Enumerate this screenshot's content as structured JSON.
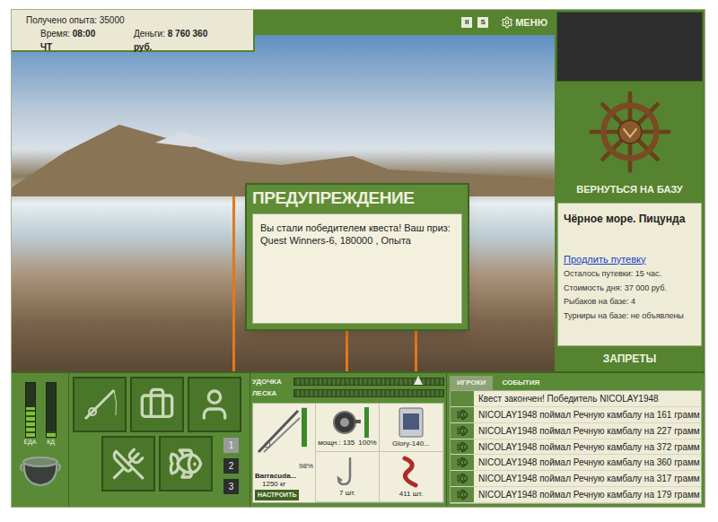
{
  "top_info": {
    "experience": "Получено опыта: 35000",
    "time_label": "Время:",
    "time": "08:00 ЧТ",
    "money_label": "Деньги:",
    "money": "8 760 360 руб."
  },
  "top_bar": {
    "buttons": [
      "II",
      "S"
    ],
    "menu": "МЕНЮ"
  },
  "dialog": {
    "title": "ПРЕДУПРЕЖДЕНИЕ",
    "text": "Вы стали победителем квеста! Ваш приз: Quest Winners-6, 180000 , Опыта"
  },
  "side_panel": {
    "back_button": "ВЕРНУТЬСЯ НА БАЗУ",
    "location": "Чёрное море. Пицунда",
    "link": "Продлить путевку",
    "info": [
      "Осталось путевки: 15 час.",
      "Стоимость дня: 37 000 руб.",
      "Рыбаков на базе: 4",
      "Турниры на базе: не объявлены"
    ],
    "bans": "ЗАПРЕТЫ"
  },
  "gauges": [
    {
      "label": "ЕДА",
      "level": 0.55
    },
    {
      "label": "КД",
      "level": 0.1
    }
  ],
  "pages": [
    {
      "label": "1",
      "selected": true
    },
    {
      "label": "2",
      "selected": false
    },
    {
      "label": "3",
      "selected": false
    }
  ],
  "tension_bars": [
    {
      "label": "УДОЧКА",
      "level": 0.8
    },
    {
      "label": "ЛЕСКА",
      "level": 0
    }
  ],
  "rod": {
    "name": "Barracuda...",
    "weight": "1250 кг",
    "condition": "98%",
    "level": 0.98,
    "button": "НАСТРОИТЬ"
  },
  "slots": [
    {
      "kind": "reel",
      "label": "мощн.: 135",
      "condition": "100%",
      "level": 1
    },
    {
      "kind": "bait",
      "label": "Glory-140..."
    },
    {
      "kind": "hook",
      "label": "7 шт."
    },
    {
      "kind": "worm",
      "label": "411 шт."
    }
  ],
  "event_tabs": [
    {
      "label": "ИГРОКИ",
      "selected": true
    },
    {
      "label": "СОБЫТИЯ",
      "selected": false
    }
  ],
  "events": [
    {
      "kind": "notice",
      "text": "Квест закончен! Победитель NICOLAY1948"
    },
    {
      "kind": "catch",
      "text": "NICOLAY1948 поймал Речную камбалу на 161 грамм"
    },
    {
      "kind": "catch",
      "text": "NICOLAY1948 поймал Речную камбалу на 227 грамм"
    },
    {
      "kind": "catch",
      "text": "NICOLAY1948 поймал Речную камбалу на 372 грамм"
    },
    {
      "kind": "catch",
      "text": "NICOLAY1948 поймал Речную камбалу на 360 грамм"
    },
    {
      "kind": "catch",
      "text": "NICOLAY1948 поймал Речную камбалу на 317 грамм"
    },
    {
      "kind": "catch",
      "text": "NICOLAY1948 поймал Речную камбалу на 179 грамм"
    }
  ]
}
